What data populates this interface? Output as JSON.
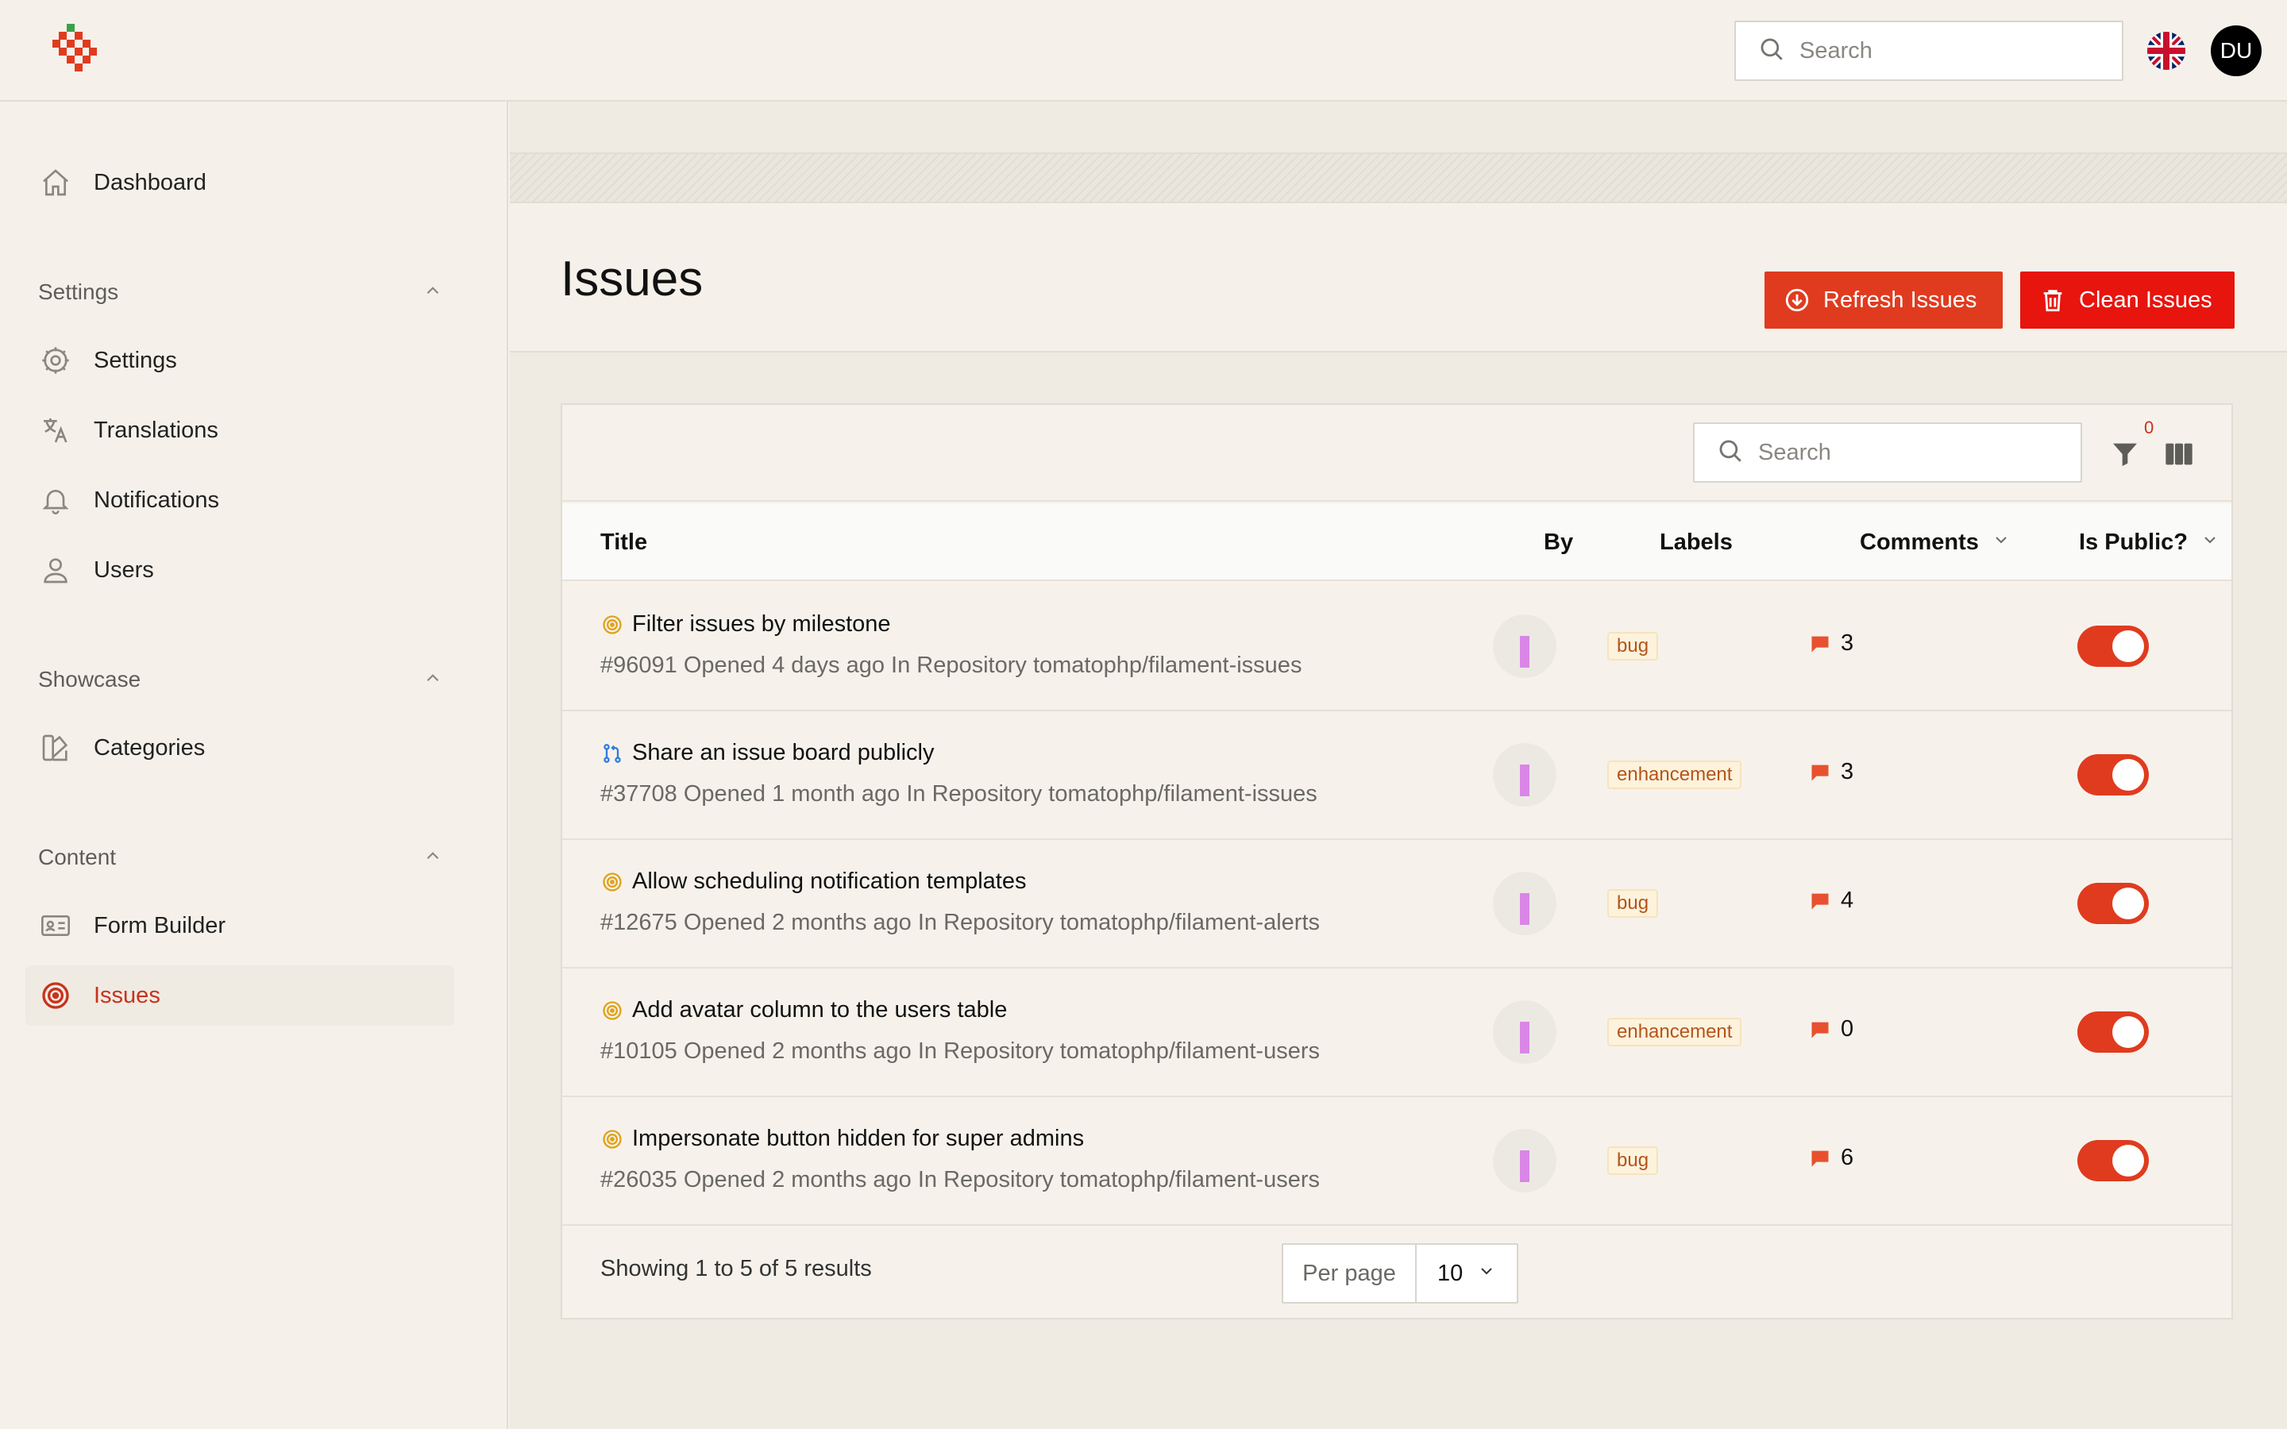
{
  "topbar": {
    "search_placeholder": "Search",
    "avatar_initials": "DU",
    "language_flag": "uk-flag-icon"
  },
  "sidebar": {
    "dashboard": "Dashboard",
    "groups": [
      {
        "label": "Settings",
        "items": [
          "Settings",
          "Translations",
          "Notifications",
          "Users"
        ]
      },
      {
        "label": "Showcase",
        "items": [
          "Categories"
        ]
      },
      {
        "label": "Content",
        "items": [
          "Form Builder",
          "Issues"
        ]
      }
    ],
    "active_item": "Issues"
  },
  "page": {
    "title": "Issues",
    "refresh_label": "Refresh Issues",
    "clean_label": "Clean Issues"
  },
  "table": {
    "search_placeholder": "Search",
    "filter_count": "0",
    "columns": {
      "title": "Title",
      "by": "By",
      "labels": "Labels",
      "comments": "Comments",
      "is_public": "Is Public?"
    },
    "rows": [
      {
        "title": "Filter issues by milestone",
        "desc": "#96091 Opened 4 days ago In Repository tomatophp/filament-issues",
        "label": "bug",
        "comments": "3",
        "is_public": true,
        "icon": "issue-open-icon"
      },
      {
        "title": "Share an issue board publicly",
        "desc": "#37708 Opened 1 month ago In Repository tomatophp/filament-issues",
        "label": "enhancement",
        "comments": "3",
        "is_public": true,
        "icon": "pull-request-icon"
      },
      {
        "title": "Allow scheduling notification templates",
        "desc": "#12675 Opened 2 months ago In Repository tomatophp/filament-alerts",
        "label": "bug",
        "comments": "4",
        "is_public": true,
        "icon": "issue-open-icon"
      },
      {
        "title": "Add avatar column to the users table",
        "desc": "#10105 Opened 2 months ago In Repository tomatophp/filament-users",
        "label": "enhancement",
        "comments": "0",
        "is_public": true,
        "icon": "issue-open-icon"
      },
      {
        "title": "Impersonate button hidden for super admins",
        "desc": "#26035 Opened 2 months ago In Repository tomatophp/filament-users",
        "label": "bug",
        "comments": "6",
        "is_public": true,
        "icon": "issue-open-icon"
      }
    ],
    "footer": {
      "results": "Showing 1 to 5 of 5 results",
      "per_page_label": "Per page",
      "per_page_value": "10"
    }
  },
  "colors": {
    "accent": "#e03b1f",
    "danger": "#e8140e",
    "background": "#f5f1ea"
  }
}
